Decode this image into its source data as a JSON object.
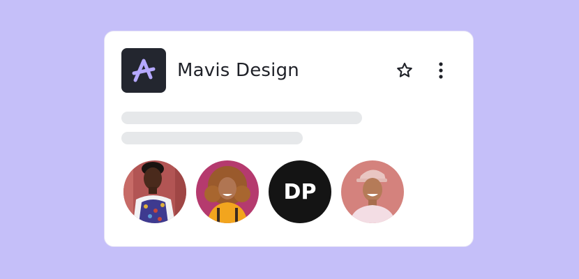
{
  "workspace": {
    "name": "Mavis Design",
    "logo_icon": "mavis-a-icon",
    "accent": "#b5a8ff",
    "logo_bg": "#23262f"
  },
  "actions": {
    "favorite_icon": "star-icon",
    "more_icon": "more-vertical-icon"
  },
  "members": [
    {
      "type": "photo",
      "name": "member-photo-1"
    },
    {
      "type": "photo",
      "name": "member-photo-2"
    },
    {
      "type": "initials",
      "initials": "DP"
    },
    {
      "type": "photo",
      "name": "member-photo-4"
    }
  ],
  "colors": {
    "page_bg": "#c5bff9",
    "card_bg": "#ffffff",
    "skeleton": "#e6e8ea",
    "initials_bg": "#141414"
  }
}
